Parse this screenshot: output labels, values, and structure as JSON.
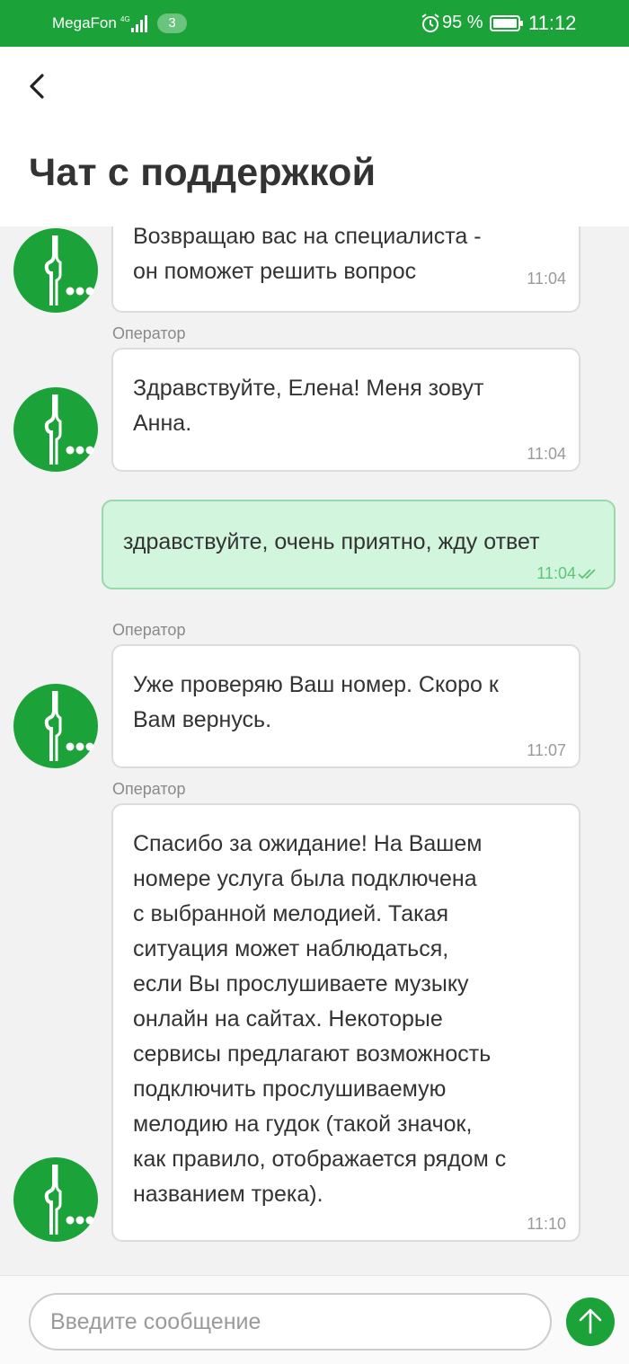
{
  "status_bar": {
    "carrier": "MegaFon",
    "sim_badge": "3",
    "battery_percent": "95 %",
    "time": "11:12"
  },
  "header": {
    "back_icon": "chevron-left-icon",
    "title": "Чат с поддержкой"
  },
  "messages": [
    {
      "sender": "operator",
      "label": "",
      "text": "Возвращаю вас на специалиста -\nон поможет решить вопрос",
      "time": "11:04"
    },
    {
      "sender": "operator",
      "label": "Оператор",
      "text": "Здравствуйте, Елена!  Меня зовут\nАнна.",
      "time": "11:04"
    },
    {
      "sender": "user",
      "text": "здравствуйте, очень приятно, жду ответ",
      "time": "11:04",
      "status_icon": "double-check-icon"
    },
    {
      "sender": "operator",
      "label": "Оператор",
      "text": "Уже проверяю Ваш номер. Скоро к\nВам вернусь.",
      "time": "11:07"
    },
    {
      "sender": "operator",
      "label": "Оператор",
      "text": "Спасибо за ожидание! На Вашем\nномере услуга была подключена\nс выбранной мелодией. Такая\nситуация может наблюдаться,\nесли Вы прослушиваете музыку\nонлайн на сайтах. Некоторые\nсервисы предлагают возможность\nподключить прослушиваемую\nмелодию на гудок (такой значок,\nкак правило, отображается рядом с\nназванием трека).",
      "time": "11:10"
    }
  ],
  "composer": {
    "placeholder": "Введите сообщение",
    "send_icon": "arrow-up-icon"
  },
  "colors": {
    "brand_green": "#1ba33a",
    "outgoing_bubble": "#d2f5dd",
    "background": "#f2f2f2"
  }
}
